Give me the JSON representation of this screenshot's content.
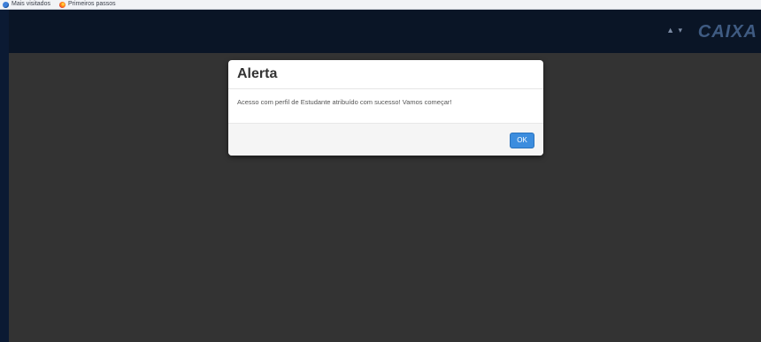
{
  "bookmarks": [
    {
      "label": "Mais visitados",
      "icon": "globe-icon"
    },
    {
      "label": "Primeiros passos",
      "icon": "firefox-icon"
    }
  ],
  "header": {
    "user_indicator": "▲ ▾",
    "brand": "CAIXA"
  },
  "modal": {
    "title": "Alerta",
    "message": "Acesso com perfil de Estudante atribuído com sucesso! Vamos começar!",
    "ok_label": "OK"
  },
  "colors": {
    "frame": "#0b1a33",
    "overlay": "#333333",
    "primary_button": "#3c8dde"
  }
}
